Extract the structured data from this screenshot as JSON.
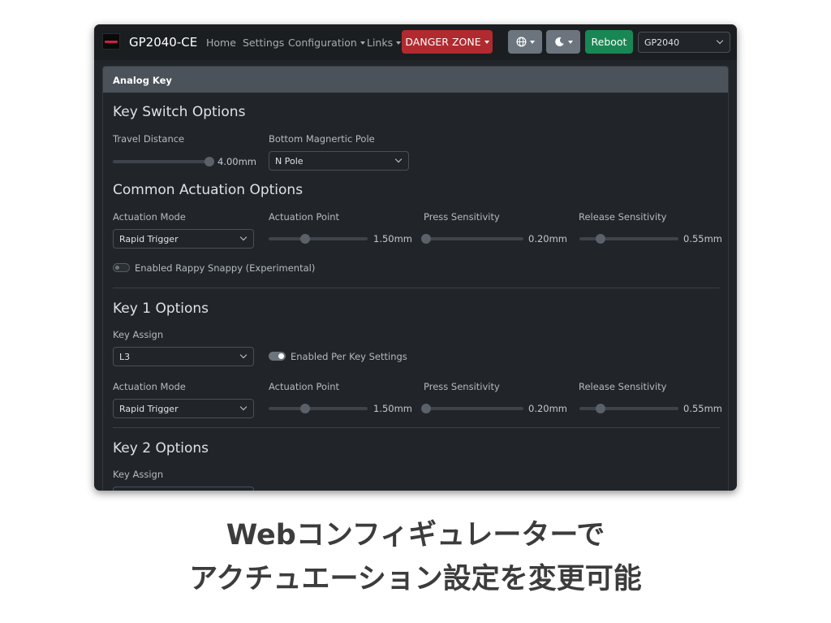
{
  "navbar": {
    "brand": "GP2040-CE",
    "links": [
      {
        "label": "Home"
      },
      {
        "label": "Settings"
      },
      {
        "label": "Configuration"
      },
      {
        "label": "Links"
      }
    ],
    "danger_label": "DANGER ZONE",
    "language_icon": "globe-icon",
    "theme_icon": "moon-icon",
    "reboot_label": "Reboot",
    "board_select": "GP2040"
  },
  "card": {
    "header": "Analog Key",
    "key_switch": {
      "title": "Key Switch Options",
      "travel_label": "Travel Distance",
      "travel_value": "4.00mm",
      "travel_fraction": 0.95,
      "pole_label": "Bottom Magnertic Pole",
      "pole_value": "N Pole"
    },
    "common": {
      "title": "Common Actuation Options",
      "mode_label": "Actuation Mode",
      "mode_value": "Rapid Trigger",
      "point_label": "Actuation Point",
      "point_value": "1.50mm",
      "point_fraction": 0.37,
      "press_label": "Press Sensitivity",
      "press_value": "0.20mm",
      "press_fraction": 0.0,
      "release_label": "Release Sensitivity",
      "release_value": "0.55mm",
      "release_fraction": 0.21,
      "snappy_label": "Enabled Rappy Snappy (Experimental)",
      "snappy_enabled": false
    },
    "key1": {
      "title": "Key 1 Options",
      "assign_label": "Key Assign",
      "assign_value": "L3",
      "per_key_label": "Enabled Per Key Settings",
      "per_key_enabled": true,
      "mode_label": "Actuation Mode",
      "mode_value": "Rapid Trigger",
      "point_label": "Actuation Point",
      "point_value": "1.50mm",
      "press_label": "Press Sensitivity",
      "press_value": "0.20mm",
      "release_label": "Release Sensitivity",
      "release_value": "0.55mm"
    },
    "key2": {
      "title": "Key 2 Options",
      "assign_label": "Key Assign"
    }
  },
  "caption": {
    "line1": "Webコンフィギュレーターで",
    "line2": "アクチュエーション設定を変更可能"
  },
  "colors": {
    "danger": "#b02a30",
    "success": "#198754",
    "secondary": "#6c757d",
    "background": "#212529"
  }
}
